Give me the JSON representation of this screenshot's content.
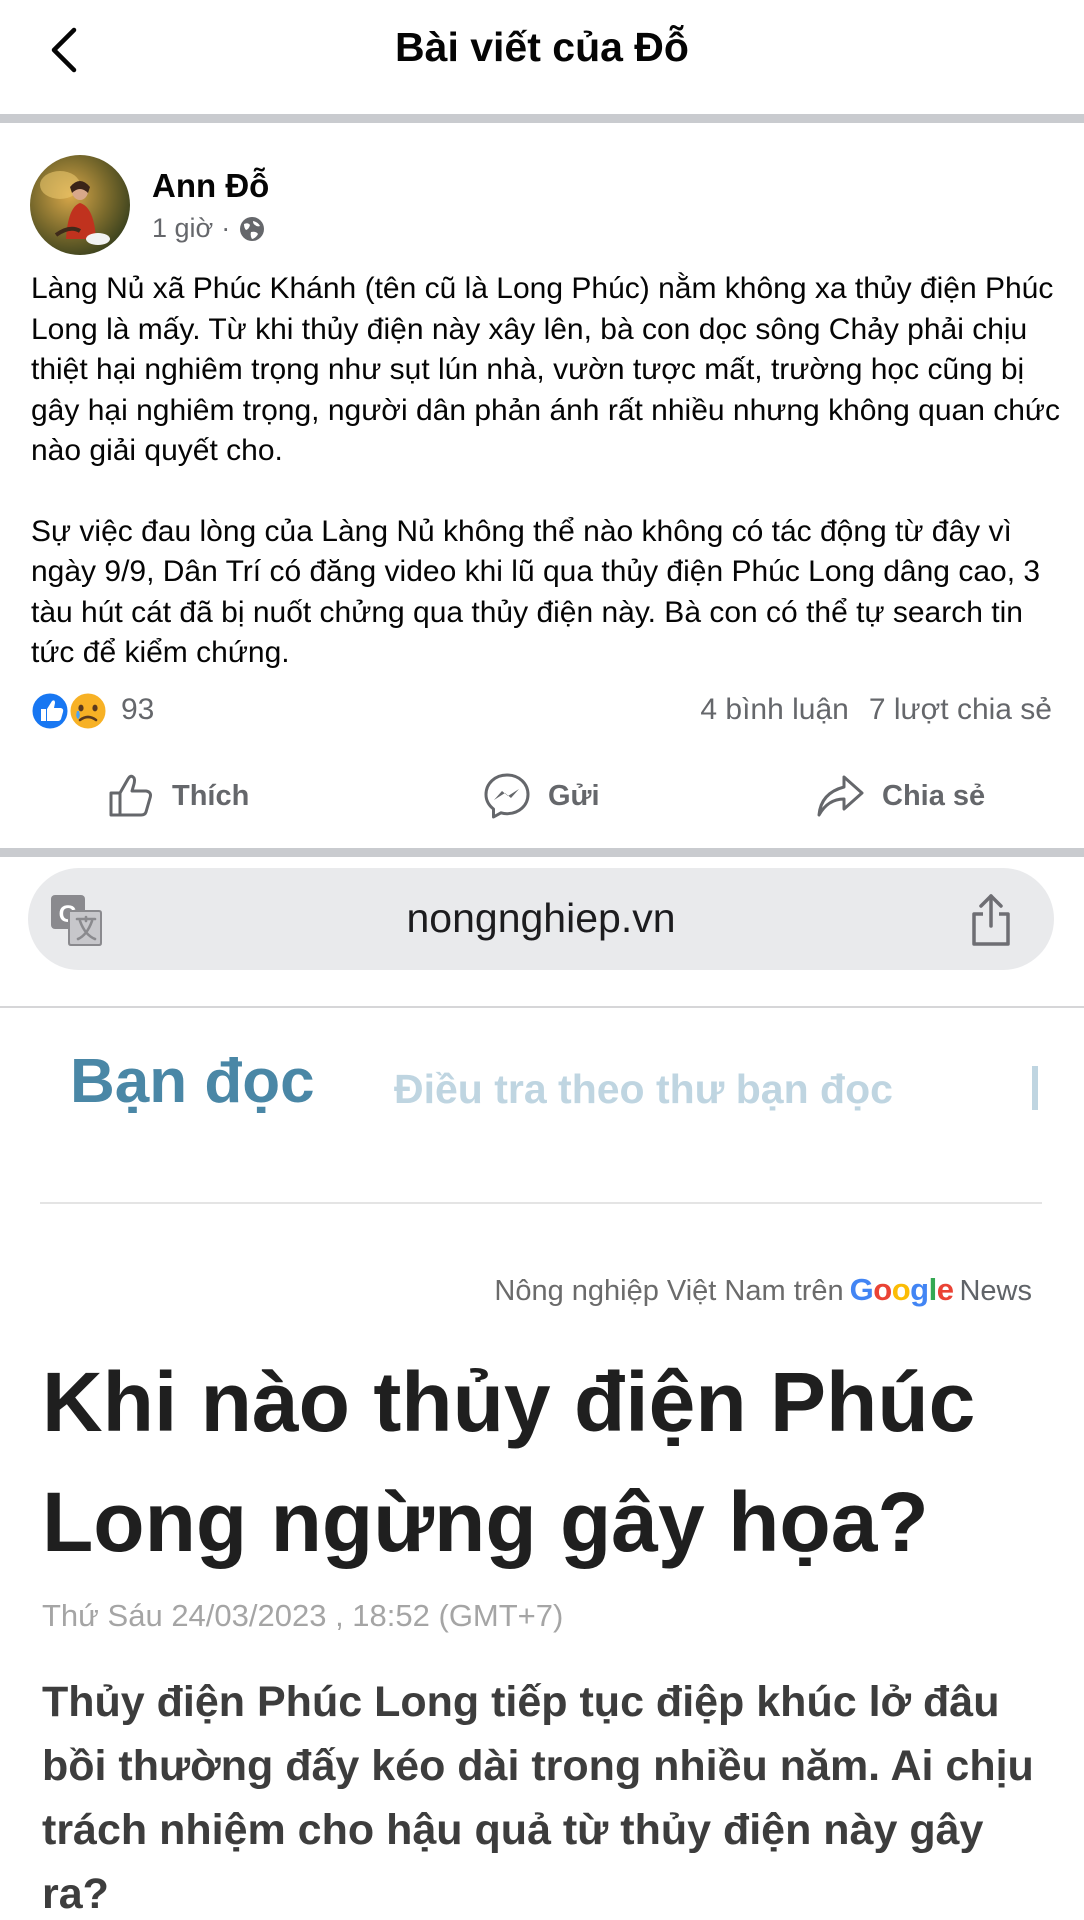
{
  "header": {
    "title": "Bài viết của Đỗ"
  },
  "post": {
    "author": "Ann Đỗ",
    "time": "1 giờ",
    "separator": "·",
    "paragraphs": [
      "Làng Nủ xã Phúc Khánh (tên cũ là Long Phúc) nằm không xa thủy điện Phúc Long là mấy. Từ khi thủy điện này xây lên, bà con dọc sông Chảy phải chịu thiệt hại nghiêm trọng như sụt lún nhà, vườn tược mất, trường học cũng bị gây hại nghiêm trọng, người dân phản ánh rất nhiều nhưng không quan chức nào giải quyết cho.",
      "Sự việc đau lòng của Làng Nủ không thể nào không có tác động từ đây vì ngày 9/9, Dân Trí có đăng video khi lũ qua thủy điện Phúc Long dâng cao, 3 tàu hút cát đã bị nuốt chửng qua thủy điện này. Bà con có thể tự search tin tức để kiểm chứng."
    ],
    "reaction_count": "93",
    "comments": "4 bình luận",
    "shares": "7 lượt chia sẻ",
    "actions": {
      "like": "Thích",
      "send": "Gửi",
      "share": "Chia sẻ"
    }
  },
  "browser": {
    "url": "nongnghiep.vn"
  },
  "article": {
    "category": "Bạn đọc",
    "subcategory": "Điều tra theo thư bạn đọc",
    "gnews_prefix": "Nông nghiệp Việt Nam trên",
    "gnews_google": [
      "G",
      "o",
      "o",
      "g",
      "l",
      "e"
    ],
    "gnews_news": "News",
    "headline": "Khi nào thủy điện Phúc Long ngừng gây họa?",
    "date": "Thứ Sáu 24/03/2023 , 18:52 (GMT+7)",
    "sapo": "Thủy điện Phúc Long tiếp tục điệp khúc lở đâu bồi thường đấy kéo dài trong nhiều năm. Ai chịu trách nhiệm cho hậu quả từ thủy điện này gây ra?"
  },
  "colors": {
    "fb_blue": "#1877f2",
    "meta_gray": "#65676b",
    "category_blue": "#4a87a6",
    "google": [
      "#4285f4",
      "#ea4335",
      "#fbbc05",
      "#4285f4",
      "#34a853",
      "#ea4335"
    ]
  },
  "icons": [
    "back-arrow-icon",
    "globe-icon",
    "like-reaction-icon",
    "sad-reaction-icon",
    "thumbs-up-icon",
    "messenger-icon",
    "share-arrow-icon",
    "translate-icon",
    "share-icon"
  ]
}
